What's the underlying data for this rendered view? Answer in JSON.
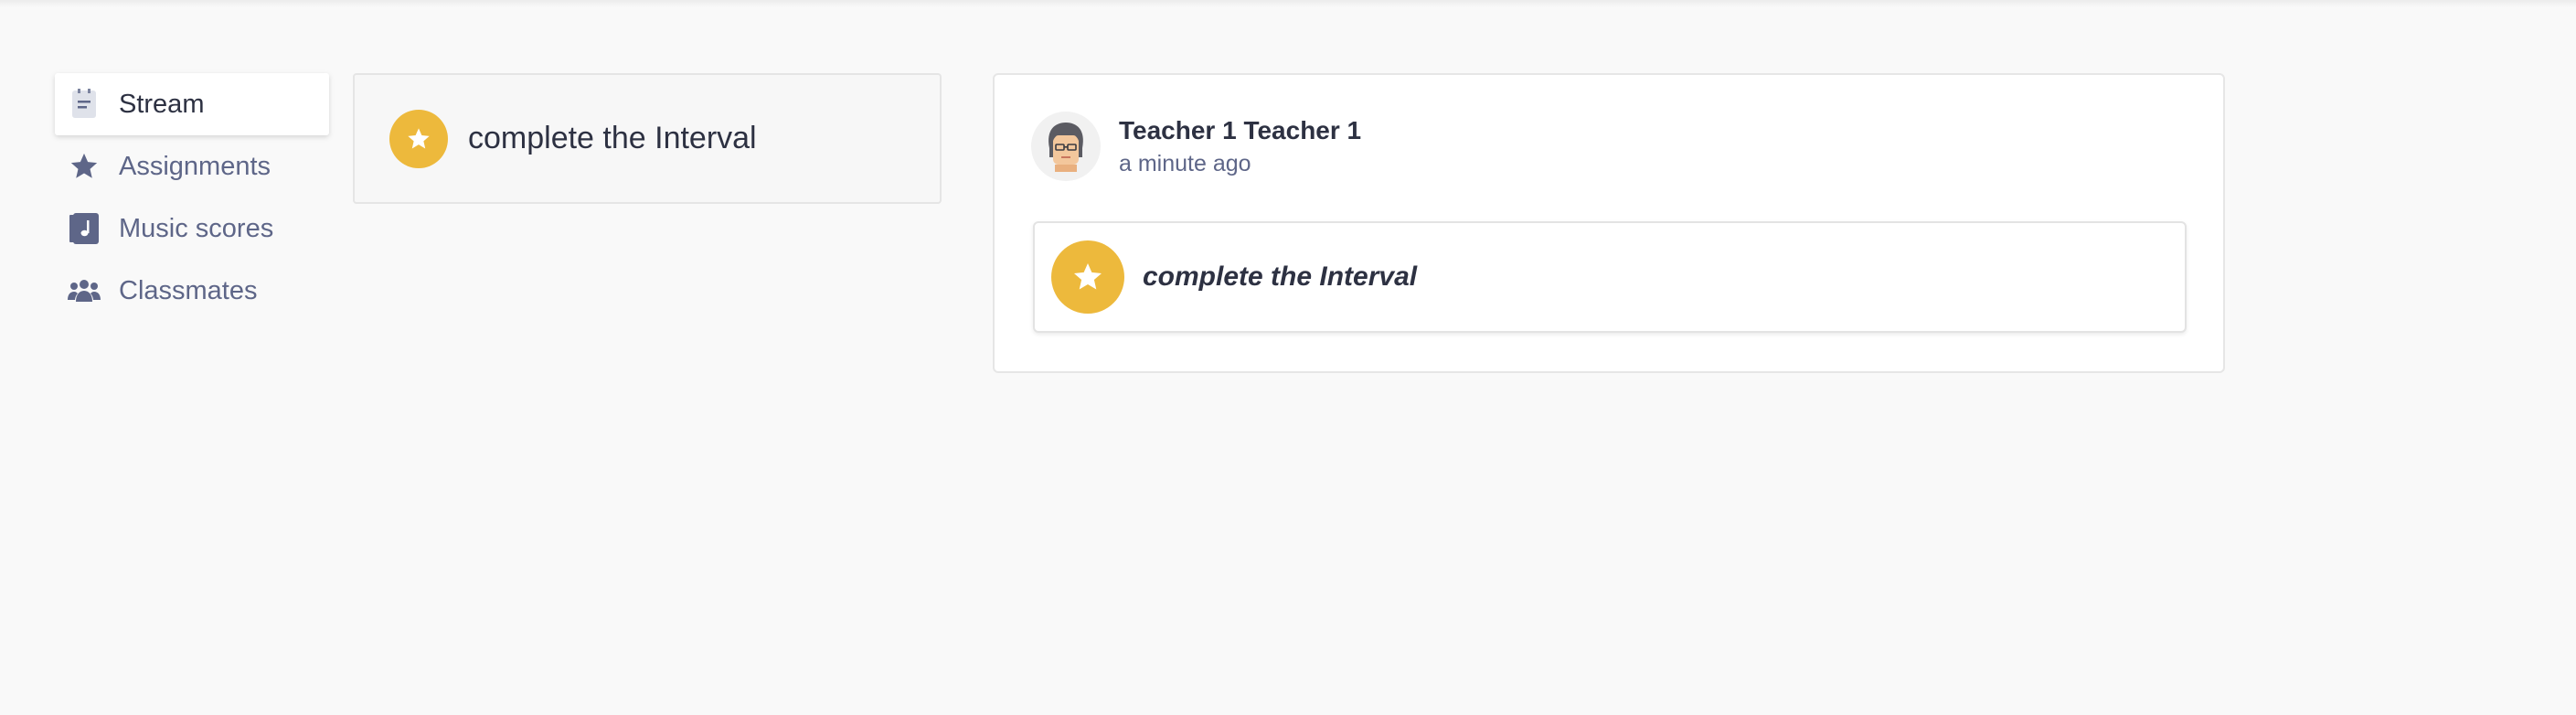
{
  "sidebar": {
    "items": [
      {
        "label": "Stream",
        "icon": "stream-icon",
        "active": true
      },
      {
        "label": "Assignments",
        "icon": "star-icon",
        "active": false
      },
      {
        "label": "Music scores",
        "icon": "music-score-icon",
        "active": false
      },
      {
        "label": "Classmates",
        "icon": "people-icon",
        "active": false
      }
    ]
  },
  "assignment_card": {
    "title": "complete the Interval",
    "icon": "star-icon"
  },
  "post": {
    "author": "Teacher 1 Teacher 1",
    "time": "a minute ago",
    "avatar": "teacher-avatar",
    "attachment": {
      "title": "complete the Interval",
      "icon": "star-icon"
    }
  },
  "colors": {
    "accent": "#edb93c",
    "nav_text": "#5e6688",
    "primary_text": "#2d3142",
    "background": "#f9f9f9"
  }
}
